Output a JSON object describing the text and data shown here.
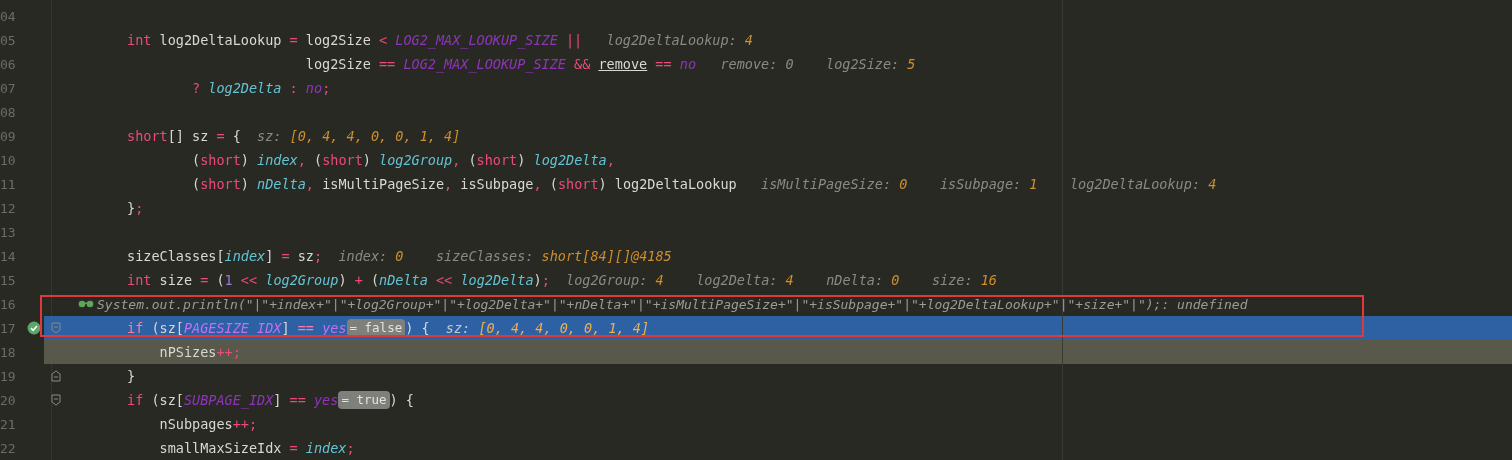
{
  "editor": {
    "lines": [
      {
        "number": "04",
        "selected": false,
        "current": false,
        "breakpoint": false,
        "fold_start": false,
        "fold_end": false
      },
      {
        "number": "05",
        "selected": false,
        "current": false,
        "breakpoint": false,
        "fold_start": false,
        "fold_end": false,
        "tokens": [
          {
            "kind": "kw",
            "text": "        int"
          },
          {
            "kind": "plain",
            "text": " log2DeltaLookup"
          },
          {
            "kind": "op",
            "text": " = "
          },
          {
            "kind": "plain",
            "text": "log2Size"
          },
          {
            "kind": "op",
            "text": " < "
          },
          {
            "kind": "const",
            "text": "LOG2_MAX_LOOKUP_SIZE"
          },
          {
            "kind": "op",
            "text": " ||"
          },
          {
            "kind": "hint",
            "text": "   log2DeltaLookup: "
          },
          {
            "kind": "hintval",
            "text": "4"
          }
        ]
      },
      {
        "number": "06",
        "selected": false,
        "current": false,
        "breakpoint": false,
        "fold_start": false,
        "fold_end": false,
        "tokens": [
          {
            "kind": "plain",
            "text": "                              log2Size"
          },
          {
            "kind": "op",
            "text": " == "
          },
          {
            "kind": "const",
            "text": "LOG2_MAX_LOOKUP_SIZE"
          },
          {
            "kind": "op",
            "text": " && "
          },
          {
            "kind": "underline",
            "text": "remove"
          },
          {
            "kind": "op",
            "text": " == "
          },
          {
            "kind": "const",
            "text": "no"
          },
          {
            "kind": "hint",
            "text": "   remove: 0"
          },
          {
            "kind": "hint",
            "text": "    log2Size: "
          },
          {
            "kind": "hintval",
            "text": "5"
          }
        ]
      },
      {
        "number": "07",
        "selected": false,
        "current": false,
        "breakpoint": false,
        "fold_start": false,
        "fold_end": false,
        "tokens": [
          {
            "kind": "op",
            "text": "                ? "
          },
          {
            "kind": "field",
            "text": "log2Delta"
          },
          {
            "kind": "op",
            "text": " : "
          },
          {
            "kind": "const",
            "text": "no"
          },
          {
            "kind": "op",
            "text": ";"
          }
        ]
      },
      {
        "number": "08",
        "selected": false,
        "current": false,
        "breakpoint": false,
        "fold_start": false,
        "fold_end": false
      },
      {
        "number": "09",
        "selected": false,
        "current": false,
        "breakpoint": false,
        "fold_start": false,
        "fold_end": false,
        "tokens": [
          {
            "kind": "kw",
            "text": "        short"
          },
          {
            "kind": "plain",
            "text": "[] sz"
          },
          {
            "kind": "op",
            "text": " = "
          },
          {
            "kind": "plain",
            "text": "{"
          },
          {
            "kind": "hint",
            "text": "  sz: "
          },
          {
            "kind": "hintval",
            "text": "[0, 4, 4, 0, 0, 1, 4]"
          }
        ]
      },
      {
        "number": "10",
        "selected": false,
        "current": false,
        "breakpoint": false,
        "fold_start": false,
        "fold_end": false,
        "tokens": [
          {
            "kind": "plain",
            "text": "                ("
          },
          {
            "kind": "kw",
            "text": "short"
          },
          {
            "kind": "plain",
            "text": ") "
          },
          {
            "kind": "field",
            "text": "index"
          },
          {
            "kind": "op",
            "text": ", "
          },
          {
            "kind": "plain",
            "text": "("
          },
          {
            "kind": "kw",
            "text": "short"
          },
          {
            "kind": "plain",
            "text": ") "
          },
          {
            "kind": "field",
            "text": "log2Group"
          },
          {
            "kind": "op",
            "text": ", "
          },
          {
            "kind": "plain",
            "text": "("
          },
          {
            "kind": "kw",
            "text": "short"
          },
          {
            "kind": "plain",
            "text": ") "
          },
          {
            "kind": "field",
            "text": "log2Delta"
          },
          {
            "kind": "op",
            "text": ","
          }
        ]
      },
      {
        "number": "11",
        "selected": false,
        "current": false,
        "breakpoint": false,
        "fold_start": false,
        "fold_end": false,
        "tokens": [
          {
            "kind": "plain",
            "text": "                ("
          },
          {
            "kind": "kw",
            "text": "short"
          },
          {
            "kind": "plain",
            "text": ") "
          },
          {
            "kind": "field",
            "text": "nDelta"
          },
          {
            "kind": "op",
            "text": ", "
          },
          {
            "kind": "plain",
            "text": "isMultiPageSize"
          },
          {
            "kind": "op",
            "text": ", "
          },
          {
            "kind": "plain",
            "text": "isSubpage"
          },
          {
            "kind": "op",
            "text": ", "
          },
          {
            "kind": "plain",
            "text": "("
          },
          {
            "kind": "kw",
            "text": "short"
          },
          {
            "kind": "plain",
            "text": ") log2DeltaLookup"
          },
          {
            "kind": "hint",
            "text": "   isMultiPageSize: "
          },
          {
            "kind": "hintval",
            "text": "0"
          },
          {
            "kind": "hint",
            "text": "    isSubpage: "
          },
          {
            "kind": "hintval",
            "text": "1"
          },
          {
            "kind": "hint",
            "text": "    log2DeltaLookup: "
          },
          {
            "kind": "hintval",
            "text": "4"
          }
        ]
      },
      {
        "number": "12",
        "selected": false,
        "current": false,
        "breakpoint": false,
        "fold_start": false,
        "fold_end": false,
        "tokens": [
          {
            "kind": "plain",
            "text": "        }"
          },
          {
            "kind": "op",
            "text": ";"
          }
        ]
      },
      {
        "number": "13",
        "selected": false,
        "current": false,
        "breakpoint": false,
        "fold_start": false,
        "fold_end": false
      },
      {
        "number": "14",
        "selected": false,
        "current": false,
        "breakpoint": false,
        "fold_start": false,
        "fold_end": false,
        "tokens": [
          {
            "kind": "plain",
            "text": "        sizeClasses["
          },
          {
            "kind": "field",
            "text": "index"
          },
          {
            "kind": "plain",
            "text": "] "
          },
          {
            "kind": "op",
            "text": "= "
          },
          {
            "kind": "plain",
            "text": "sz"
          },
          {
            "kind": "op",
            "text": ";"
          },
          {
            "kind": "hint",
            "text": "  index: "
          },
          {
            "kind": "hintval",
            "text": "0"
          },
          {
            "kind": "hint",
            "text": "    sizeClasses: "
          },
          {
            "kind": "hintval",
            "text": "short[84][]@4185"
          }
        ]
      },
      {
        "number": "15",
        "selected": false,
        "current": false,
        "breakpoint": false,
        "fold_start": false,
        "fold_end": false,
        "tokens": [
          {
            "kind": "kw",
            "text": "        int"
          },
          {
            "kind": "plain",
            "text": " size "
          },
          {
            "kind": "op",
            "text": "= "
          },
          {
            "kind": "plain",
            "text": "("
          },
          {
            "kind": "num",
            "text": "1"
          },
          {
            "kind": "op",
            "text": " << "
          },
          {
            "kind": "field",
            "text": "log2Group"
          },
          {
            "kind": "plain",
            "text": ") "
          },
          {
            "kind": "op",
            "text": "+ "
          },
          {
            "kind": "plain",
            "text": "("
          },
          {
            "kind": "field",
            "text": "nDelta"
          },
          {
            "kind": "op",
            "text": " << "
          },
          {
            "kind": "field",
            "text": "log2Delta"
          },
          {
            "kind": "plain",
            "text": ")"
          },
          {
            "kind": "op",
            "text": ";"
          },
          {
            "kind": "hint",
            "text": "  log2Group: "
          },
          {
            "kind": "hintval",
            "text": "4"
          },
          {
            "kind": "hint",
            "text": "    log2Delta: "
          },
          {
            "kind": "hintval",
            "text": "4"
          },
          {
            "kind": "hint",
            "text": "    nDelta: "
          },
          {
            "kind": "hintval",
            "text": "0"
          },
          {
            "kind": "hint",
            "text": "    size: "
          },
          {
            "kind": "hintval",
            "text": "16"
          }
        ]
      },
      {
        "number": "16",
        "selected": false,
        "current": false,
        "breakpoint": false,
        "fold_start": false,
        "fold_end": false,
        "framed": true,
        "evaluation": "System.out.println(\"|\"+index+\"|\"+log2Group+\"|\"+log2Delta+\"|\"+nDelta+\"|\"+isMultiPageSize+\"|\"+isSubpage+\"|\"+log2DeltaLookup+\"|\"+size+\"|\");: undefined"
      },
      {
        "number": "17",
        "selected": true,
        "current": false,
        "breakpoint": true,
        "fold_start": true,
        "fold_end": false,
        "tokens": [
          {
            "kind": "kw",
            "text": "        if"
          },
          {
            "kind": "plain",
            "text": " (sz["
          },
          {
            "kind": "const",
            "text": "PAGESIZE_IDX"
          },
          {
            "kind": "plain",
            "text": "] "
          },
          {
            "kind": "op",
            "text": "== "
          },
          {
            "kind": "const",
            "text": "yes"
          },
          {
            "kind": "badge",
            "text": "= false"
          },
          {
            "kind": "plain",
            "text": ") {"
          },
          {
            "kind": "hint",
            "text": "  sz: "
          },
          {
            "kind": "hintval",
            "text": "[0, 4, 4, 0, 0, 1, 4]"
          }
        ]
      },
      {
        "number": "18",
        "selected": false,
        "current": true,
        "breakpoint": false,
        "fold_start": false,
        "fold_end": false,
        "tokens": [
          {
            "kind": "plain",
            "text": "            nPSizes"
          },
          {
            "kind": "op",
            "text": "++;"
          }
        ]
      },
      {
        "number": "19",
        "selected": false,
        "current": false,
        "breakpoint": false,
        "fold_start": false,
        "fold_end": true,
        "tokens": [
          {
            "kind": "plain",
            "text": "        }"
          }
        ]
      },
      {
        "number": "20",
        "selected": false,
        "current": false,
        "breakpoint": false,
        "fold_start": true,
        "fold_end": false,
        "tokens": [
          {
            "kind": "kw",
            "text": "        if"
          },
          {
            "kind": "plain",
            "text": " (sz["
          },
          {
            "kind": "const",
            "text": "SUBPAGE_IDX"
          },
          {
            "kind": "plain",
            "text": "] "
          },
          {
            "kind": "op",
            "text": "== "
          },
          {
            "kind": "const",
            "text": "yes"
          },
          {
            "kind": "badge",
            "text": "= true"
          },
          {
            "kind": "plain",
            "text": ") {"
          }
        ]
      },
      {
        "number": "21",
        "selected": false,
        "current": false,
        "breakpoint": false,
        "fold_start": false,
        "fold_end": false,
        "tokens": [
          {
            "kind": "plain",
            "text": "            nSubpages"
          },
          {
            "kind": "op",
            "text": "++;"
          }
        ]
      },
      {
        "number": "22",
        "selected": false,
        "current": false,
        "breakpoint": false,
        "fold_start": false,
        "fold_end": false,
        "tokens": [
          {
            "kind": "plain",
            "text": "            smallMaxSizeIdx "
          },
          {
            "kind": "op",
            "text": "= "
          },
          {
            "kind": "field",
            "text": "index"
          },
          {
            "kind": "op",
            "text": ";"
          }
        ]
      }
    ]
  }
}
